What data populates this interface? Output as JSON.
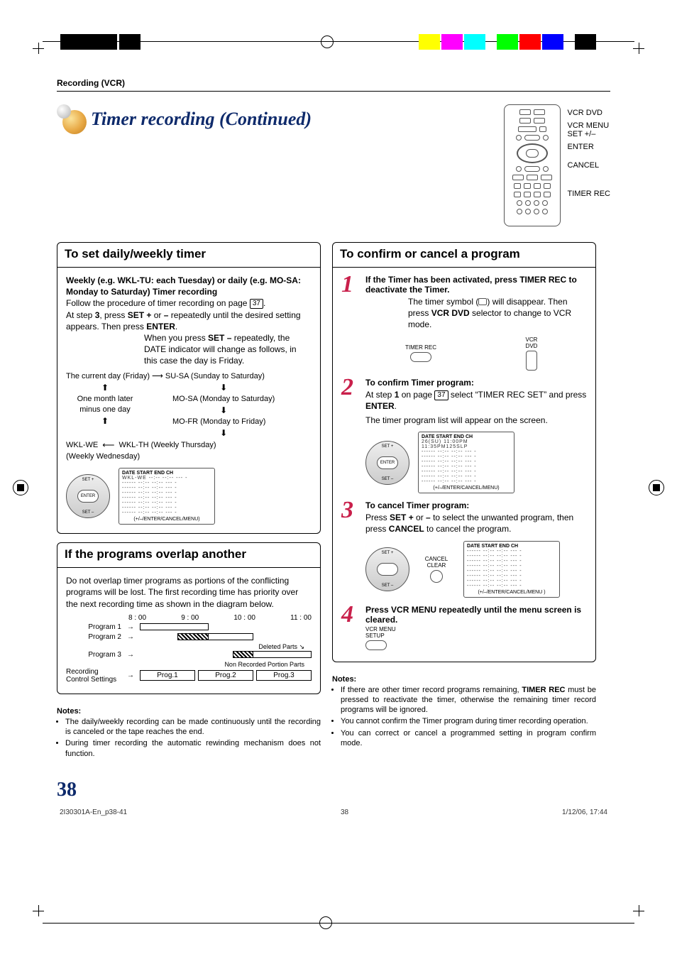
{
  "section_label": "Recording (VCR)",
  "title": "Timer recording (Continued)",
  "remote_labels": {
    "l1": "VCR DVD",
    "l2a": "VCR MENU",
    "l2b": "SET +/–",
    "l3": "ENTER",
    "l4": "CANCEL",
    "l5": "TIMER REC"
  },
  "left": {
    "panel1": {
      "heading": "To set daily/weekly timer",
      "strong1": "Weekly (e.g. WKL-TU: each Tuesday) or daily (e.g. MO-SA: Monday to Saturday) Timer recording",
      "p1a": "Follow the procedure of timer recording on page ",
      "p1_pg": "37",
      "p1b": ".",
      "p2a": "At step ",
      "p2_b": "3",
      "p2c": ", press ",
      "p2_key1": "SET +",
      "p2d": " or ",
      "p2_key2": "–",
      "p2e": " repeatedly until the desired setting appears. Then press ",
      "p2_key3": "ENTER",
      "p2f": ".",
      "p3a": "When you press ",
      "p3_key": "SET –",
      "p3b": " repeatedly, the DATE indicator will change as follows, in this case the day is Friday.",
      "flow": {
        "r1": "The current day (Friday)  ⟶  SU-SA (Sunday to Saturday)",
        "r2a": "One month later",
        "r2b": "minus one day",
        "r3": "MO-SA (Monday to Saturday)",
        "r4": "MO-FR (Monday to Friday)",
        "r5a": "WKL-WE",
        "r5arr": "⟵",
        "r5b": "WKL-TH (Weekly Thursday)",
        "r6": "(Weekly Wednesday)"
      },
      "dial_labels": {
        "top": "SET +",
        "center": "ENTER",
        "bottom": "SET –"
      },
      "osd": {
        "hdr": "DATE   START  END   CH",
        "row1": "WKL-WE  --:--  --:--  --- -",
        "dash": "------  --:--  --:--  --- -",
        "footer": "(+/–/ENTER/CANCEL/MENU)"
      }
    },
    "panel2": {
      "heading": "If the programs overlap another",
      "p1": "Do not overlap timer programs as portions of the conflicting programs will be lost. The first recording time has priority over the next recording time as shown in the diagram below.",
      "times": [
        "8 : 00",
        "9 : 00",
        "10 : 00",
        "11 : 00"
      ],
      "rows": [
        "Program 1",
        "Program 2",
        "Program 3",
        "Recording",
        "Control Settings"
      ],
      "ann1": "Deleted Parts",
      "ann2": "Non Recorded Portion Parts",
      "boxes": [
        "Prog.1",
        "Prog.2",
        "Prog.3"
      ]
    },
    "notes": {
      "h": "Notes:",
      "n1": "The daily/weekly recording can be made continuously until the recording is canceled or the tape reaches the end.",
      "n2": "During timer recording the automatic rewinding mechanism does not function."
    }
  },
  "right": {
    "heading": "To confirm or cancel a program",
    "s1": {
      "head_a": "If the Timer has been activated, press TIMER REC to deactivate the Timer.",
      "p_a": "The timer symbol (",
      "p_b": ") will disappear. Then press ",
      "p_key": "VCR DVD",
      "p_c": " selector to change to VCR mode.",
      "btn1": "TIMER REC",
      "btn2a": "VCR",
      "btn2b": "DVD"
    },
    "s2": {
      "head": "To confirm Timer program:",
      "p_a": "At step ",
      "p_b": "1",
      "p_c": " on page ",
      "p_pg": "37",
      "p_d": " select “TIMER REC SET” and press ",
      "p_key": "ENTER",
      "p_e": ".",
      "p2": "The timer program list will appear on the screen.",
      "dial": {
        "top": "SET +",
        "center": "ENTER",
        "bottom": "SET –"
      },
      "osd": {
        "hdr": "DATE   START   END   CH",
        "row": "26(SU) 11:00PM 11:35PM125SLP",
        "dash": "------  --:--  --:--  --- -",
        "footer": "(+/–/ENTER/CANCEL/MENU)"
      }
    },
    "s3": {
      "head": "To cancel Timer program:",
      "p_a": "Press ",
      "p_k1": "SET +",
      "p_b": " or ",
      "p_k2": "–",
      "p_c": " to select the unwanted program, then press ",
      "p_k3": "CANCEL",
      "p_d": " to cancel the program.",
      "dial": {
        "top": "SET +",
        "bottom": "SET –"
      },
      "cancel": "CANCEL\nCLEAR",
      "osd": {
        "hdr": "DATE   START   END   CH",
        "dash": "------  --:--  --:--  --- -",
        "footer": "(+/–/ENTER/CANCEL/MENU )"
      }
    },
    "s4": {
      "head": "Press VCR MENU repeatedly until the menu screen is cleared.",
      "btn": "VCR MENU\nSETUP"
    },
    "notes": {
      "h": "Notes:",
      "n1_a": "If there are other timer record programs remaining, ",
      "n1_b": "TIMER REC",
      "n1_c": " must be pressed to reactivate the timer, otherwise the remaining timer record programs will be ignored.",
      "n2": "You cannot confirm the Timer program during timer recording operation.",
      "n3": "You can correct or cancel a programmed setting in program confirm mode."
    }
  },
  "page_number": "38",
  "footer": {
    "left": "2I30301A-En_p38-41",
    "center": "38",
    "right": "1/12/06, 17:44"
  }
}
